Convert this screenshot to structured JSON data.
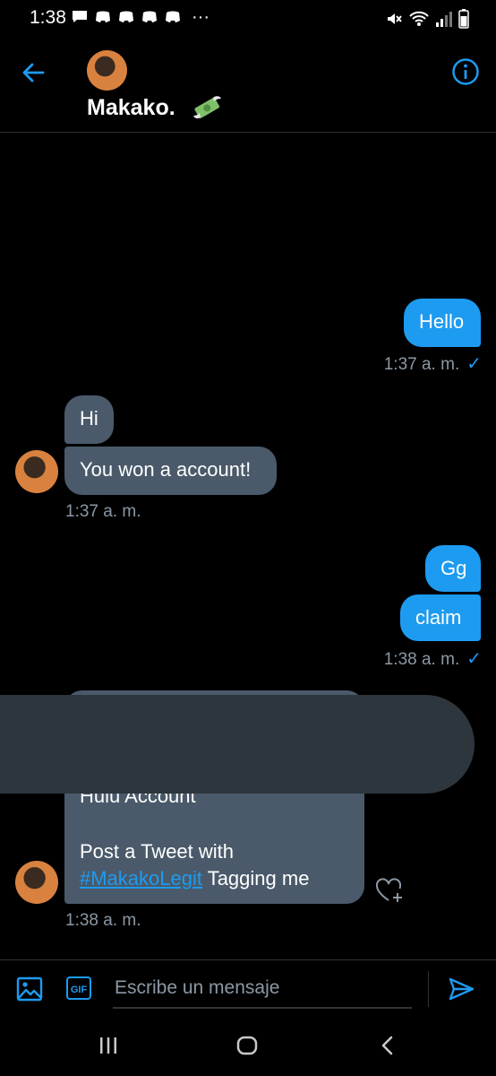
{
  "status_bar": {
    "time": "1:38",
    "more": "···"
  },
  "header": {
    "contact_name": "Makako.",
    "back_icon": "arrow-left-icon",
    "info_icon": "info-icon",
    "emoji_icon": "flying-money-icon"
  },
  "messages": [
    {
      "direction": "out",
      "text": "Hello",
      "time": "1:37 a. m."
    },
    {
      "direction": "in",
      "text": "Hi"
    },
    {
      "direction": "in",
      "text": "You won a account!",
      "time": "1:37 a. m."
    },
    {
      "direction": "out",
      "text": "Gg"
    },
    {
      "direction": "out",
      "text": "claim",
      "time": "1:38 a. m."
    },
    {
      "direction": "in",
      "line1": "Hulu Account",
      "line2": "Post a Tweet with",
      "hashtag": "#MakakoLegit",
      "line3_rest": " Tagging me",
      "time": "1:38 a. m."
    }
  ],
  "read_check": "✓",
  "composer": {
    "placeholder": "Escribe un mensaje",
    "gif_label": "GIF"
  },
  "colors": {
    "accent": "#1d9bf0",
    "incoming_bubble": "#4a5a6a",
    "background": "#000000"
  }
}
